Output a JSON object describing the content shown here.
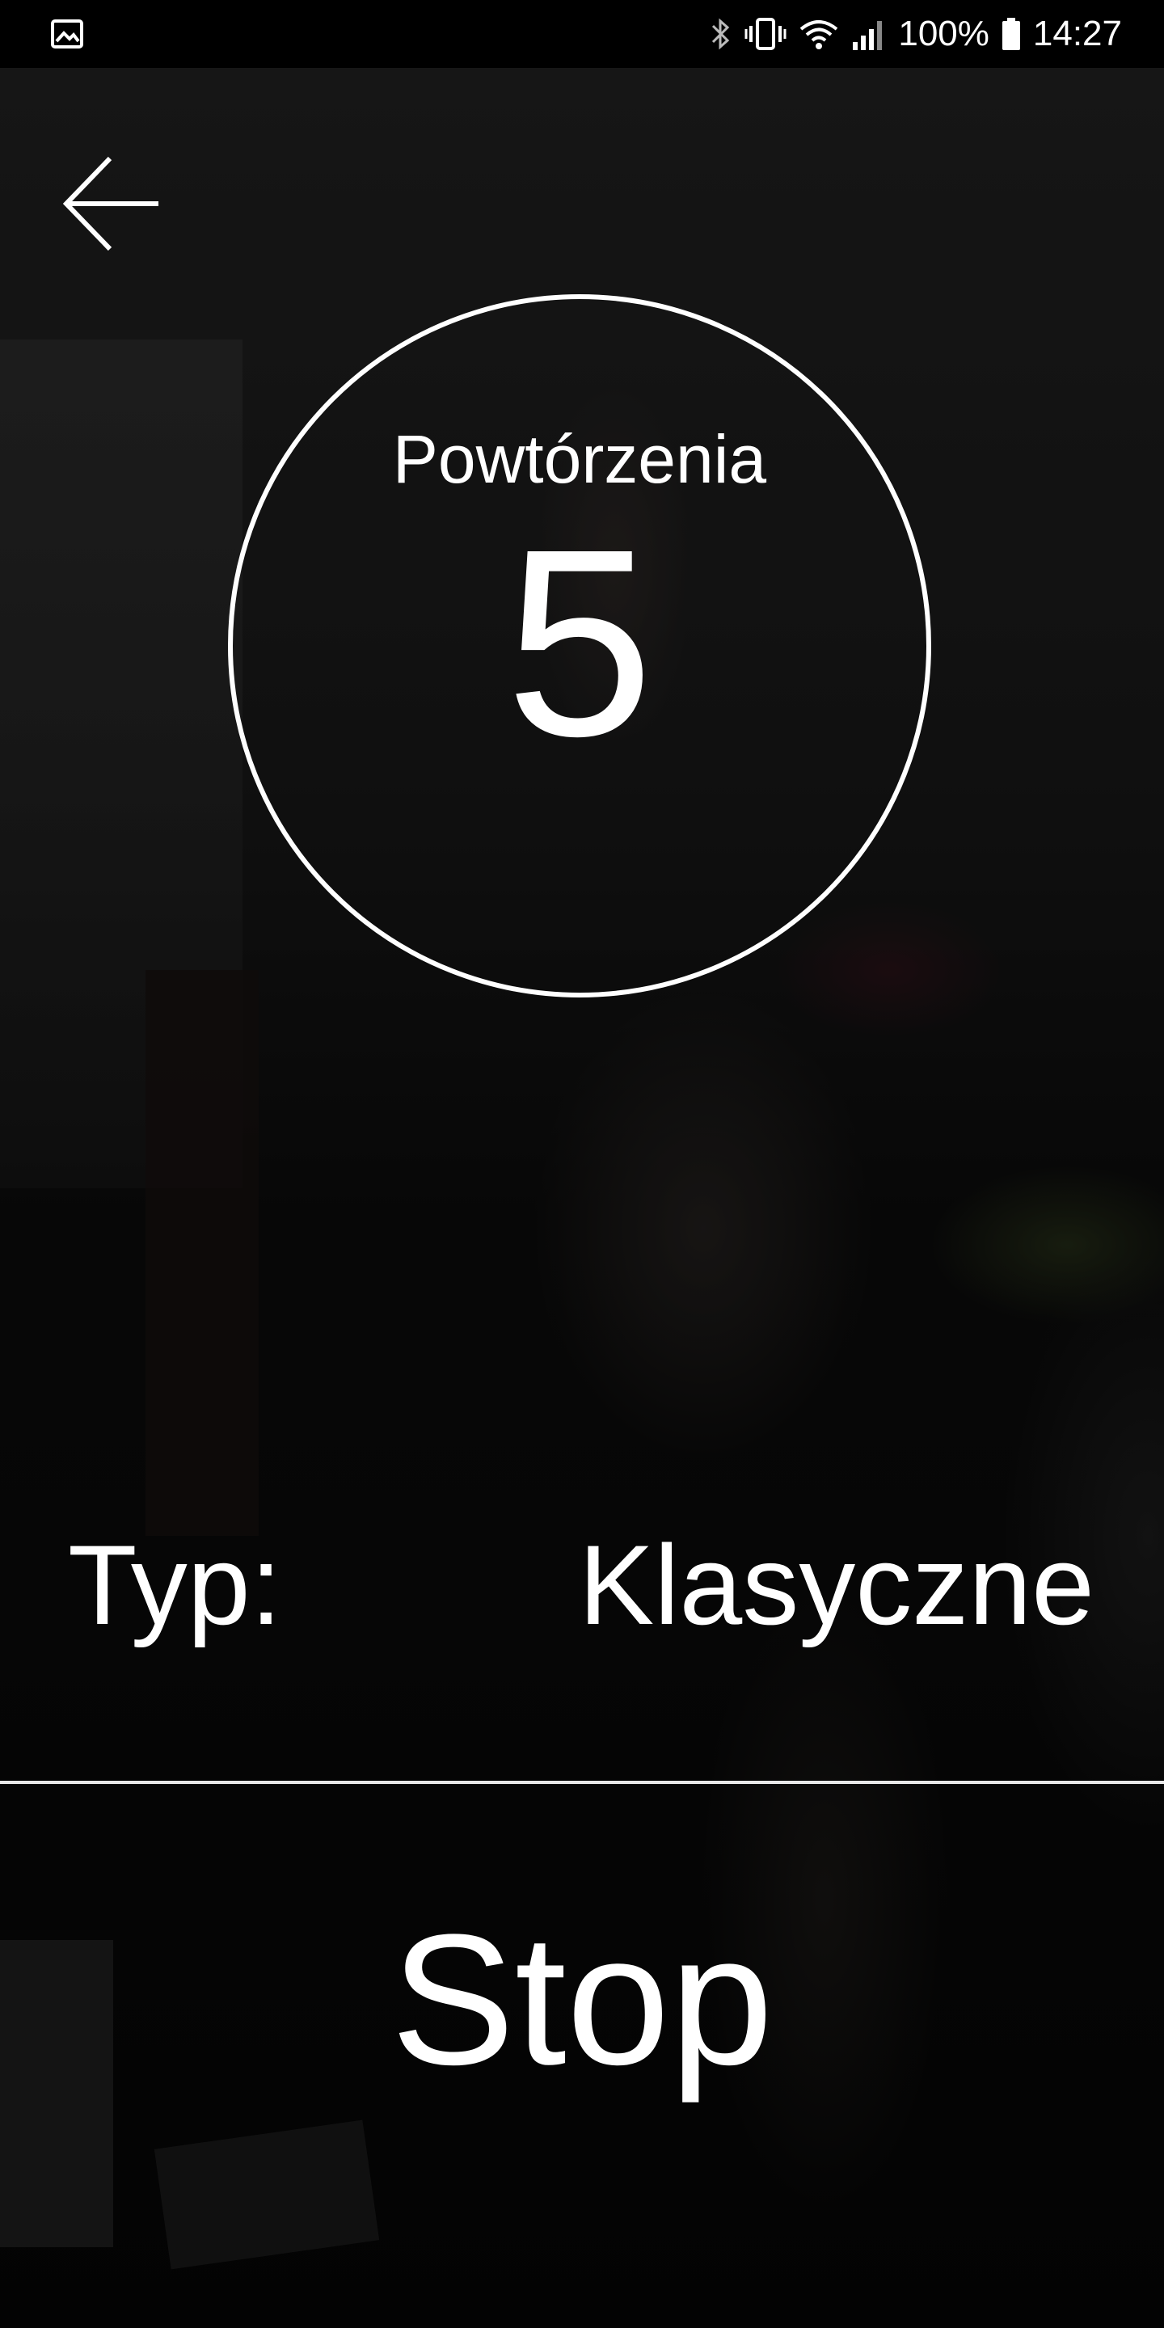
{
  "status_bar": {
    "icons": {
      "gallery": "image-icon",
      "bluetooth": "bluetooth-icon",
      "vibrate": "vibrate-icon",
      "wifi": "wifi-icon",
      "signal": "signal-icon",
      "battery": "battery-icon"
    },
    "battery_percent": "100%",
    "time": "14:27"
  },
  "header": {
    "back_icon": "arrow-left-icon"
  },
  "counter": {
    "label": "Powtórzenia",
    "value": "5"
  },
  "exercise_type": {
    "label": "Typ:",
    "value": "Klasyczne"
  },
  "actions": {
    "stop_label": "Stop"
  },
  "colors": {
    "text": "#ffffff",
    "background": "#000000",
    "divider": "#e8e8e8"
  }
}
